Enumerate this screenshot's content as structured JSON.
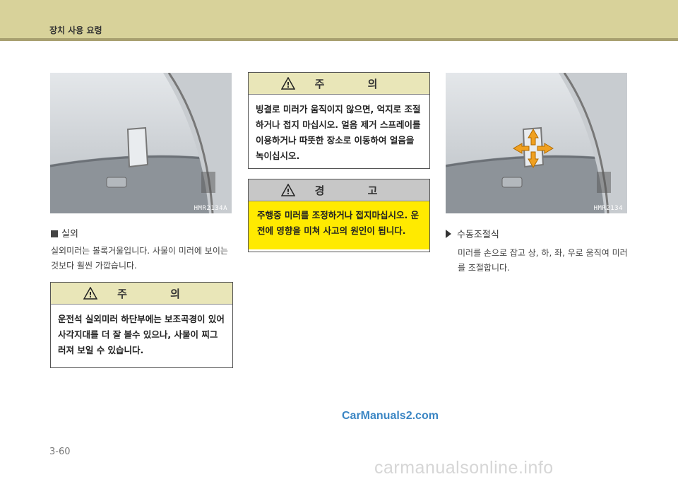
{
  "header": {
    "title": "장치 사용 요령"
  },
  "photos": {
    "left_code": "HMR2134A",
    "right_code": "HMR2134"
  },
  "section": {
    "title": "실외",
    "body": "실외미러는 볼록거울입니다. 사물이 미러에 보이는 것보다 훨씬 가깝습니다."
  },
  "caution_left": {
    "title": "주 의",
    "body": "운전석 실외미러 하단부에는 보조곡경이 있어 사각지대를 더 잘 볼수 있으나, 사물이 찌그러져 보일 수 있습니다."
  },
  "caution_mid": {
    "title": "주 의",
    "body": "빙결로 미러가 움직이지 않으면, 억지로 조절하거나 접지 마십시오. 얼음 제거 스프레이를 이용하거나 따뜻한 장소로 이동하여 얼음을 녹이십시오."
  },
  "warning": {
    "title": "경 고",
    "body": "주행중 미러를 조정하거나 접지마십시오. 운전에 영향을 미쳐 사고의 원인이 됩니다."
  },
  "manual": {
    "title": "수동조절식",
    "body": "미러를 손으로 잡고 상, 하, 좌, 우로 움직여 미러를 조절합니다."
  },
  "watermark": "CarManuals2.com",
  "page_number": "3-60",
  "footer_watermark": "carmanualsonline.info",
  "colors": {
    "header": "#d8d29a",
    "caution_head": "#e9e6b8",
    "warning_body": "#ffea00",
    "arrow": "#f0a020"
  }
}
